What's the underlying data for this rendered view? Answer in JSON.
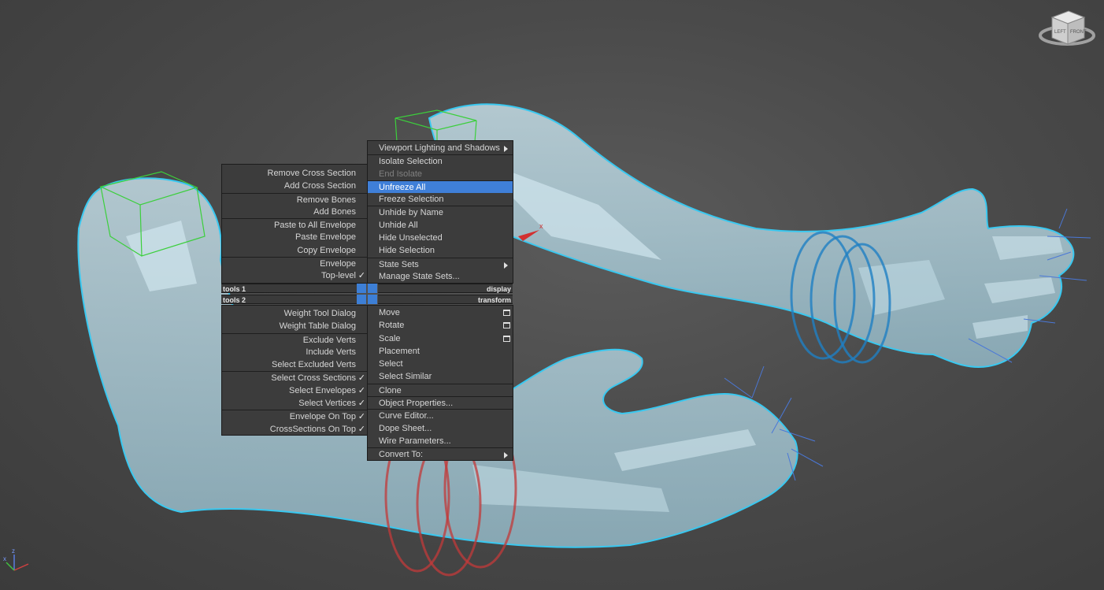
{
  "viewcube": {
    "face_labels": [
      "LEFT",
      "FRONT"
    ]
  },
  "axis_gizmo": {
    "up": "z",
    "left": "x"
  },
  "gizmo_label": "x",
  "quad_menu": {
    "left_upper_header": "tools 1",
    "left_lower_header": "tools 2",
    "right_upper_header": "display",
    "right_lower_header": "transform",
    "left_upper": [
      {
        "label": "Remove Cross Section"
      },
      {
        "label": "Add Cross Section"
      },
      {
        "label": "Remove Bones"
      },
      {
        "label": "Add Bones"
      },
      {
        "label": "Paste to All Envelope"
      },
      {
        "label": "Paste Envelope"
      },
      {
        "label": "Copy Envelope"
      },
      {
        "label": "Envelope"
      },
      {
        "label": "Top-level",
        "check": "✓"
      }
    ],
    "left_lower": [
      {
        "label": "Weight Tool Dialog"
      },
      {
        "label": "Weight Table Dialog"
      },
      {
        "label": "Exclude Verts"
      },
      {
        "label": "Include Verts"
      },
      {
        "label": "Select Excluded Verts"
      },
      {
        "label": "Select Cross Sections",
        "check": "✓"
      },
      {
        "label": "Select Envelopes",
        "check": "✓"
      },
      {
        "label": "Select Vertices",
        "check": "✓"
      },
      {
        "label": "Envelope On Top",
        "check": "✓"
      },
      {
        "label": "CrossSections On Top",
        "check": "✓"
      }
    ],
    "right_upper": [
      {
        "label": "Viewport Lighting and Shadows"
      },
      {
        "label": "Isolate Selection"
      },
      {
        "label": "End Isolate"
      },
      {
        "label": "Unfreeze All"
      },
      {
        "label": "Freeze Selection"
      },
      {
        "label": "Unhide by Name"
      },
      {
        "label": "Unhide All"
      },
      {
        "label": "Hide Unselected"
      },
      {
        "label": "Hide Selection"
      },
      {
        "label": "State Sets"
      },
      {
        "label": "Manage State Sets..."
      }
    ],
    "right_lower": [
      {
        "label": "Move"
      },
      {
        "label": "Rotate"
      },
      {
        "label": "Scale"
      },
      {
        "label": "Placement"
      },
      {
        "label": "Select"
      },
      {
        "label": "Select Similar"
      },
      {
        "label": "Clone"
      },
      {
        "label": "Object Properties..."
      },
      {
        "label": "Curve Editor..."
      },
      {
        "label": "Dope Sheet..."
      },
      {
        "label": "Wire Parameters..."
      },
      {
        "label": "Convert To:"
      }
    ]
  }
}
